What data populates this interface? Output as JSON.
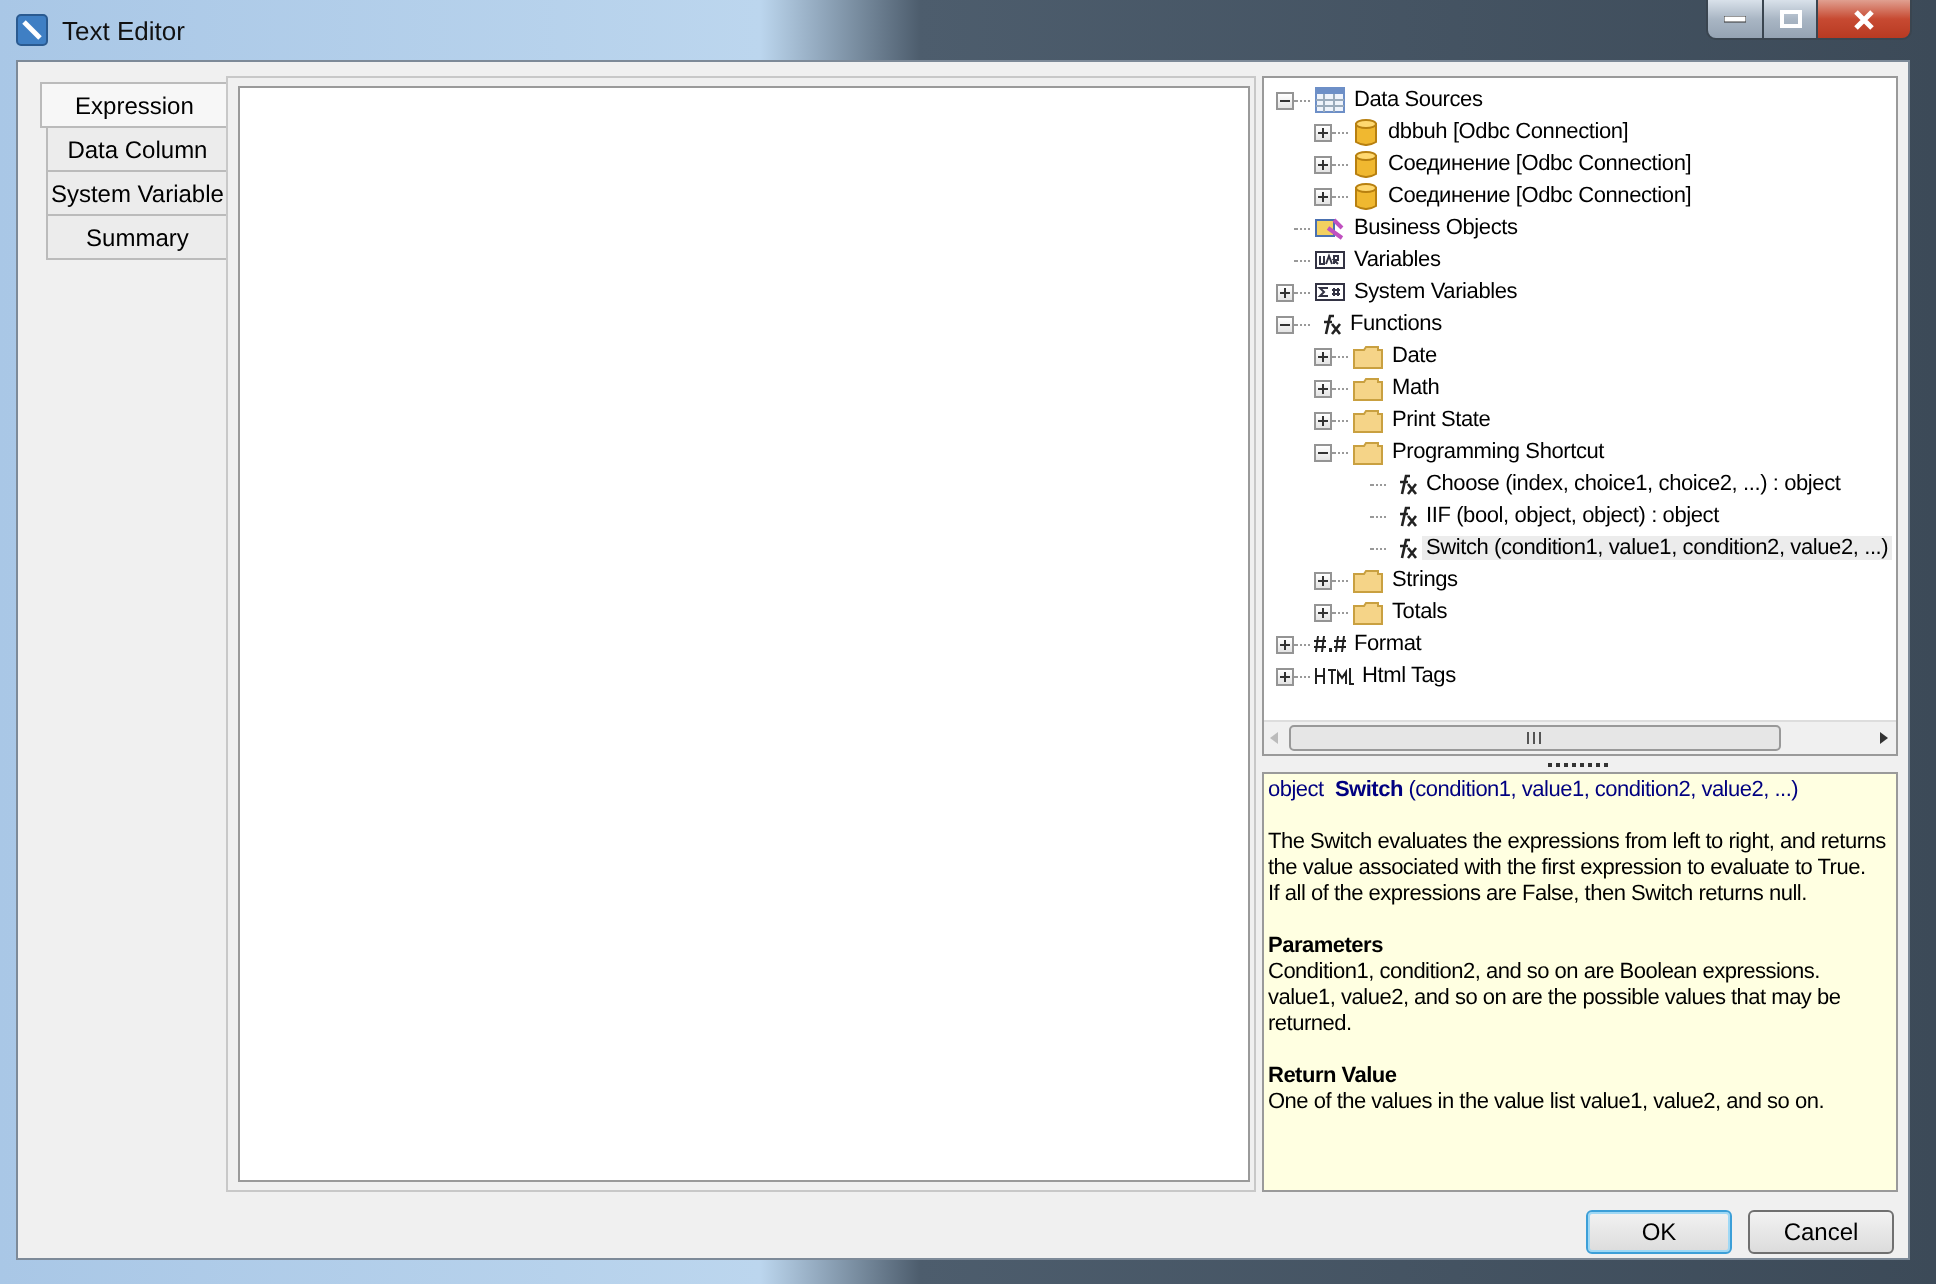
{
  "window": {
    "title": "Text Editor"
  },
  "tabs": [
    {
      "label": "Expression",
      "selected": true
    },
    {
      "label": "Data Column",
      "selected": false
    },
    {
      "label": "System Variable",
      "selected": false
    },
    {
      "label": "Summary",
      "selected": false
    }
  ],
  "tree": [
    {
      "label": "Data Sources",
      "kind": "table",
      "expanded": true,
      "selected": false,
      "children": [
        {
          "label": "dbbuh [Odbc Connection]",
          "kind": "database",
          "expanded": false,
          "selected": false
        },
        {
          "label": "Соединение [Odbc Connection]",
          "kind": "database",
          "expanded": false,
          "selected": false
        },
        {
          "label": "Соединение [Odbc Connection]",
          "kind": "database",
          "expanded": false,
          "selected": false
        }
      ]
    },
    {
      "label": "Business Objects",
      "kind": "objects",
      "selected": false
    },
    {
      "label": "Variables",
      "kind": "variable",
      "selected": false
    },
    {
      "label": "System Variables",
      "kind": "sysvar",
      "expanded": false,
      "selected": false
    },
    {
      "label": "Functions",
      "kind": "function",
      "expanded": true,
      "selected": false,
      "children": [
        {
          "label": "Date",
          "kind": "folder",
          "expanded": false,
          "selected": false
        },
        {
          "label": "Math",
          "kind": "folder",
          "expanded": false,
          "selected": false
        },
        {
          "label": "Print State",
          "kind": "folder",
          "expanded": false,
          "selected": false
        },
        {
          "label": "Programming Shortcut",
          "kind": "folder",
          "expanded": true,
          "selected": false,
          "children": [
            {
              "label": "Choose (index, choice1, choice2, ...) : object",
              "kind": "function",
              "selected": false
            },
            {
              "label": "IIF (bool, object, object) : object",
              "kind": "function",
              "selected": false
            },
            {
              "label": "Switch (condition1, value1, condition2, value2, ...)",
              "kind": "function",
              "selected": true
            }
          ]
        },
        {
          "label": "Strings",
          "kind": "folder",
          "expanded": false,
          "selected": false
        },
        {
          "label": "Totals",
          "kind": "folder",
          "expanded": false,
          "selected": false
        }
      ]
    },
    {
      "label": "Format",
      "kind": "format",
      "expanded": false,
      "selected": false
    },
    {
      "label": "Html Tags",
      "kind": "html",
      "expanded": false,
      "selected": false
    }
  ],
  "description": {
    "signature": "object  **Switch** (condition1, value1, condition2, value2, ...)",
    "blocks": [
      {
        "lines": [
          "The Switch evaluates the expressions from left to right, and returns the value associated with the first expression to evaluate to True.",
          "If all of the expressions are False, then Switch returns null."
        ]
      },
      {
        "heading": "Parameters",
        "lines": [
          "Condition1, condition2, and so on are Boolean expressions.",
          "value1, value2, and so on are the possible values that may be returned."
        ]
      },
      {
        "heading": "Return Value",
        "lines": [
          "One of the values in the value list value1, value2, and so on."
        ]
      }
    ]
  },
  "buttons": [
    {
      "label": "OK",
      "default": true
    },
    {
      "label": "Cancel",
      "default": false
    }
  ]
}
